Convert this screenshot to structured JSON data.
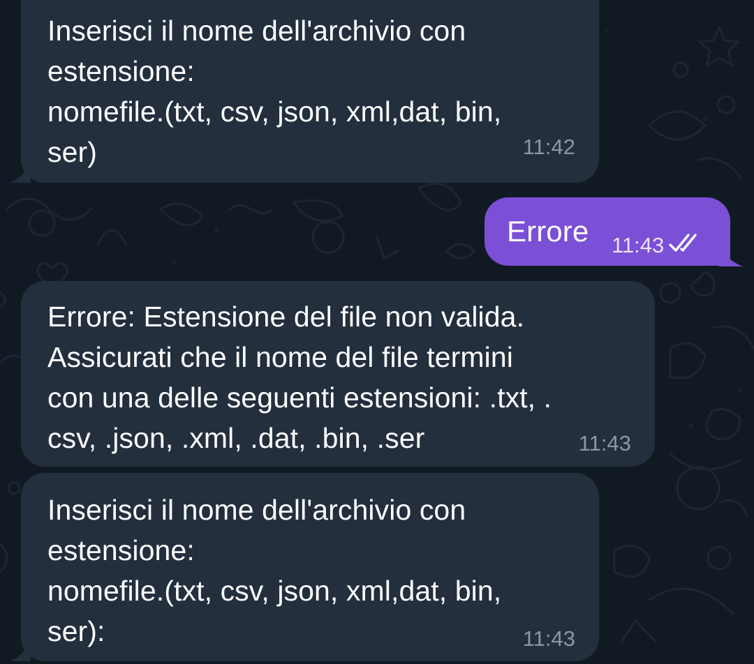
{
  "chat": {
    "messages": [
      {
        "direction": "incoming",
        "text": "Inserisci il nome dell'archivio con\nestensione:\nnomefile.(txt, csv, json, xml,dat, bin,\nser)",
        "time": "11:42"
      },
      {
        "direction": "outgoing",
        "text": "Errore",
        "time": "11:43",
        "status_icon": "double-check-icon"
      },
      {
        "direction": "incoming",
        "text": "Errore: Estensione del file non valida.\nAssicurati che il nome del file termini\ncon una delle seguenti estensioni: .txt, .\ncsv, .json, .xml, .dat, .bin, .ser",
        "time": "11:43"
      },
      {
        "direction": "incoming",
        "text": "Inserisci il nome dell'archivio con\nestensione:\nnomefile.(txt, csv, json, xml,dat, bin,\nser):",
        "time": "11:43"
      }
    ]
  },
  "colors": {
    "background": "#111a22",
    "incoming_bubble": "#242f3d",
    "outgoing_bubble": "#7b4fd6",
    "incoming_time": "#8a97a8",
    "outgoing_time": "#e9e2fb",
    "text": "#ffffff"
  }
}
